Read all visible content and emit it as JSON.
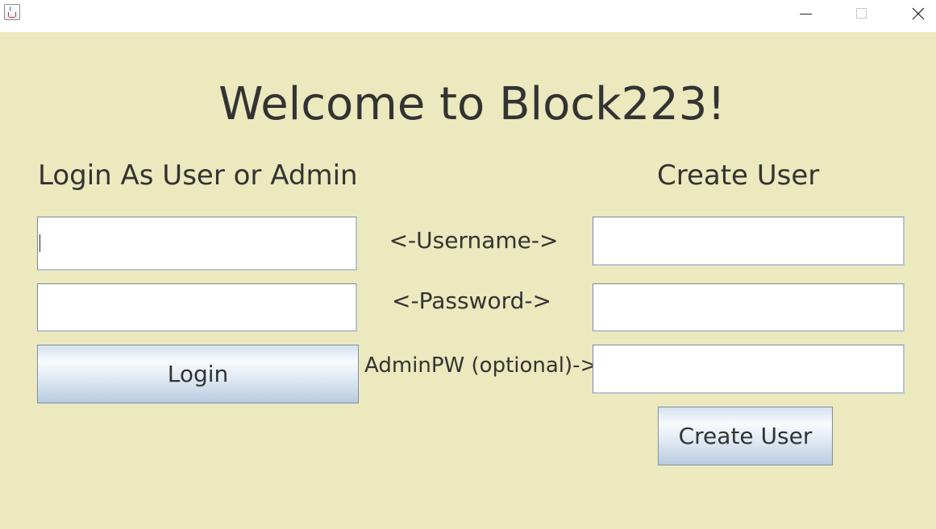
{
  "window": {
    "controls": {
      "minimize_icon": "minimize-icon",
      "maximize_icon": "maximize-icon",
      "close_icon": "close-icon"
    },
    "app_icon": "java-cup-icon",
    "background_color": "#ebe9bd"
  },
  "title": "Welcome to Block223!",
  "login": {
    "heading": "Login As User or Admin",
    "username_value": "",
    "password_value": "",
    "button_label": "Login"
  },
  "labels": {
    "username": "<-Username->",
    "password": "<-Password->",
    "admin_pw": "AdminPW (optional)->"
  },
  "create": {
    "heading": "Create User",
    "username_value": "",
    "password_value": "",
    "admin_pw_value": "",
    "button_label": "Create User"
  }
}
